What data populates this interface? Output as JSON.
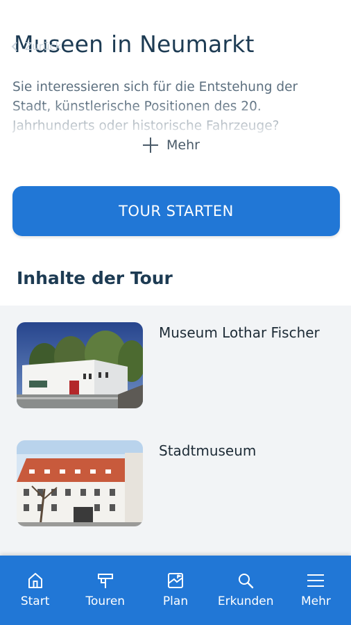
{
  "header": {
    "back_label": "Zurück",
    "title": "Museen in Neumarkt"
  },
  "intro": {
    "text": "Sie interessieren sich für die Entstehung der Stadt, künstlerische Positionen des 20. Jahrhunderts oder historische Fahrzeuge?",
    "more_label": "Mehr"
  },
  "actions": {
    "start_tour_label": "TOUR STARTEN"
  },
  "section": {
    "title": "Inhalte der Tour"
  },
  "tour_items": [
    {
      "name": "Museum Lothar Fischer"
    },
    {
      "name": "Stadtmuseum"
    }
  ],
  "bottom_nav": [
    {
      "label": "Start",
      "icon": "home-icon"
    },
    {
      "label": "Touren",
      "icon": "signpost-icon"
    },
    {
      "label": "Plan",
      "icon": "map-icon"
    },
    {
      "label": "Erkunden",
      "icon": "search-icon"
    },
    {
      "label": "Mehr",
      "icon": "menu-icon"
    }
  ],
  "colors": {
    "primary": "#2177d6",
    "title": "#1d3b53",
    "body_text": "#5c6f7f",
    "list_background": "#f2f4f6"
  }
}
